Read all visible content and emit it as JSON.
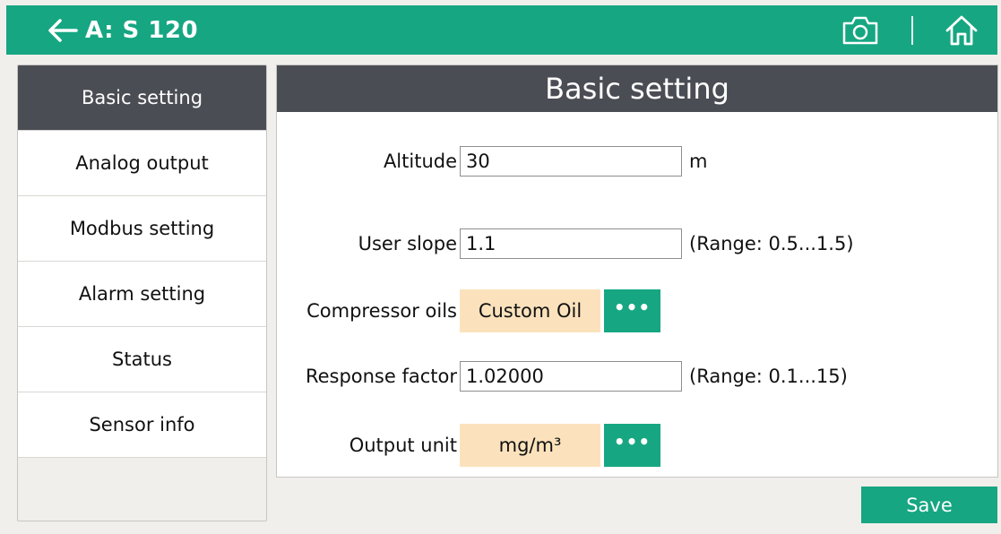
{
  "header": {
    "title": "A: S 120",
    "back_icon": "arrow-left-icon",
    "camera_icon": "camera-icon",
    "home_icon": "home-icon"
  },
  "sidebar": {
    "items": [
      {
        "label": "Basic setting",
        "active": true
      },
      {
        "label": "Analog output"
      },
      {
        "label": "Modbus setting"
      },
      {
        "label": "Alarm setting"
      },
      {
        "label": "Status"
      },
      {
        "label": "Sensor info"
      }
    ]
  },
  "panel": {
    "title": "Basic setting",
    "altitude": {
      "label": "Altitude",
      "value": "30",
      "unit": "m"
    },
    "user_slope": {
      "label": "User slope",
      "value": "1.1",
      "range": "(Range: 0.5...1.5)"
    },
    "compressor_oils": {
      "label": "Compressor oils",
      "value": "Custom Oil",
      "more": "•••"
    },
    "response_factor": {
      "label": "Response factor",
      "value": "1.02000",
      "range": "(Range: 0.1...15)"
    },
    "output_unit": {
      "label": "Output unit",
      "value": "mg/m³",
      "more": "•••"
    }
  },
  "footer": {
    "save_label": "Save"
  },
  "colors": {
    "accent": "#16a682",
    "header_dark": "#4b4d54",
    "select_bg": "#fbe2bc",
    "background": "#f1efec"
  }
}
